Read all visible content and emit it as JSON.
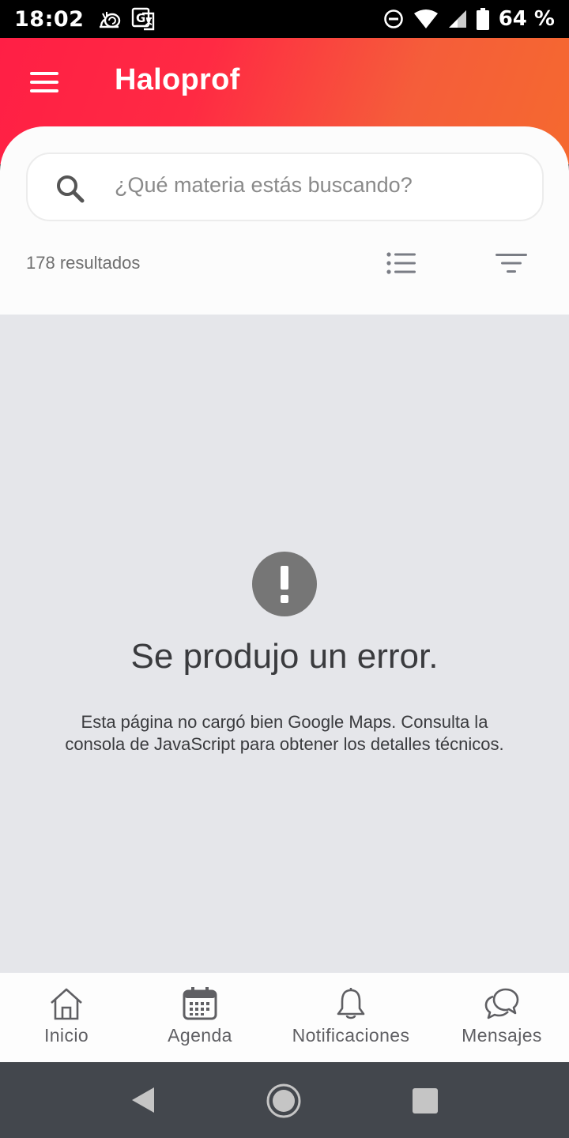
{
  "status_bar": {
    "time": "18:02",
    "battery": "64 %",
    "icons": [
      "snail-icon",
      "translate-icon",
      "do-not-disturb-icon",
      "wifi-icon",
      "signal-icon",
      "battery-icon"
    ]
  },
  "header": {
    "title": "Haloprof",
    "menu_icon": "hamburger-menu-icon"
  },
  "search": {
    "placeholder": "¿Qué materia estás buscando?",
    "results": "178 resultados"
  },
  "map_error": {
    "title": "Se produjo un error.",
    "message": "Esta página no cargó bien Google Maps. Consulta la consola de JavaScript para obtener los detalles técnicos."
  },
  "bottom_nav": {
    "items": [
      {
        "label": "Inicio",
        "icon": "home-icon"
      },
      {
        "label": "Agenda",
        "icon": "calendar-icon"
      },
      {
        "label": "Notificaciones",
        "icon": "bell-icon"
      },
      {
        "label": "Mensajes",
        "icon": "chat-bubbles-icon"
      }
    ]
  },
  "colors": {
    "header_start": "#ff1f45",
    "header_end": "#f5692f",
    "map_background": "#e5e6ea",
    "system_nav": "#43474d"
  }
}
